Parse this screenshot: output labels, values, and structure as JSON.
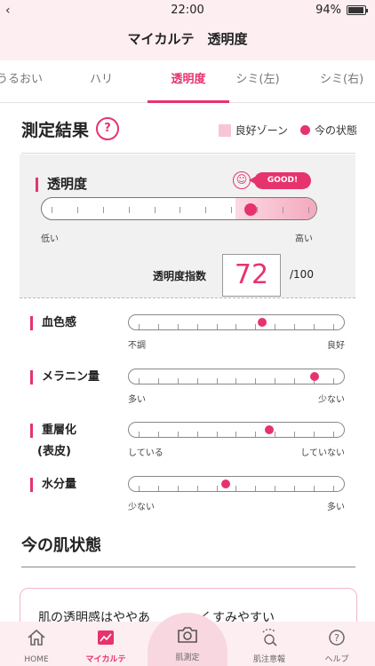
{
  "status": {
    "time": "22:00",
    "battery": "94%"
  },
  "header": {
    "title": "マイカルテ　透明度"
  },
  "tabs": [
    {
      "label": "うるおい",
      "active": false
    },
    {
      "label": "ハリ",
      "active": false
    },
    {
      "label": "透明度",
      "active": true
    },
    {
      "label": "シミ(左)",
      "active": false
    },
    {
      "label": "シミ(右)",
      "active": false
    }
  ],
  "result": {
    "title": "測定結果",
    "help": "?",
    "legend_good": "良好ゾーン",
    "legend_current": "今の状態"
  },
  "main": {
    "label": "透明度",
    "badge": "GOOD!",
    "low": "低い",
    "high": "高い",
    "index_label": "透明度指数",
    "index_value": "72",
    "index_max": "/100",
    "position": 0.76,
    "good_zone_start": 0.7
  },
  "metrics": [
    {
      "label": "血色感",
      "label2": "",
      "left": "不調",
      "right": "良好",
      "position": 0.62
    },
    {
      "label": "メラニン量",
      "label2": "",
      "left": "多い",
      "right": "少ない",
      "position": 0.86
    },
    {
      "label": "重層化",
      "label2": "(表皮)",
      "left": "している",
      "right": "していない",
      "position": 0.65
    },
    {
      "label": "水分量",
      "label2": "",
      "left": "少ない",
      "right": "多い",
      "position": 0.45
    }
  ],
  "skin": {
    "title": "今の肌状態",
    "text": "肌の透明感はややあ　　　　くすみやすい"
  },
  "nav": {
    "home": "HOME",
    "karte": "マイカルテ",
    "measure": "肌測定",
    "alert": "肌注意報",
    "help": "ヘルプ"
  },
  "colors": {
    "accent": "#e6336e",
    "header_bg": "#fdeef1",
    "good_zone": "#f8c5d4"
  }
}
